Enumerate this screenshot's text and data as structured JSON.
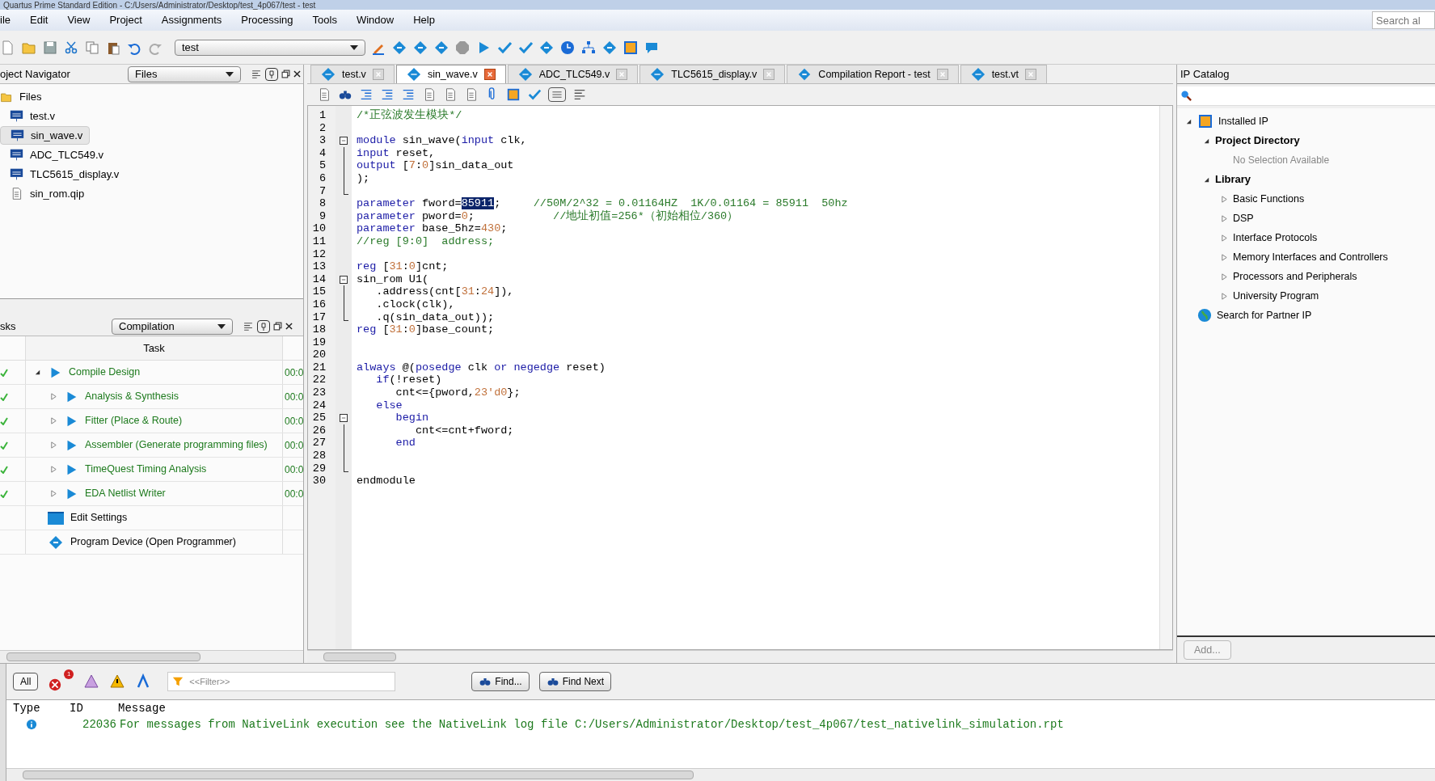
{
  "window": {
    "title": "Quartus Prime Standard Edition - C:/Users/Administrator/Desktop/test_4p067/test - test"
  },
  "menu": [
    "ile",
    "Edit",
    "View",
    "Project",
    "Assignments",
    "Processing",
    "Tools",
    "Window",
    "Help"
  ],
  "search": {
    "placeholder": "Search al"
  },
  "toolbar": {
    "revision": "test"
  },
  "navigator": {
    "title": "oject Navigator",
    "view": "Files",
    "files": [
      {
        "label": "Files",
        "kind": "folder",
        "selected": false
      },
      {
        "label": "test.v",
        "kind": "verilog",
        "selected": false
      },
      {
        "label": "sin_wave.v",
        "kind": "verilog",
        "selected": true
      },
      {
        "label": "ADC_TLC549.v",
        "kind": "verilog",
        "selected": false
      },
      {
        "label": "TLC5615_display.v",
        "kind": "verilog",
        "selected": false
      },
      {
        "label": "sin_rom.qip",
        "kind": "qip",
        "selected": false
      }
    ]
  },
  "tasks": {
    "title": "sks",
    "flow": "Compilation",
    "column": "Task",
    "rows": [
      {
        "label": "Compile Design",
        "kind": "flow",
        "done": true,
        "expanded": true,
        "time": "00:0",
        "children": [
          {
            "label": "Analysis & Synthesis",
            "kind": "flow",
            "done": true,
            "expanded": false,
            "time": "00:0"
          },
          {
            "label": "Fitter (Place & Route)",
            "kind": "flow",
            "done": true,
            "expanded": false,
            "time": "00:0"
          },
          {
            "label": "Assembler (Generate programming files)",
            "kind": "flow",
            "done": true,
            "expanded": false,
            "time": "00:0"
          },
          {
            "label": "TimeQuest Timing Analysis",
            "kind": "flow",
            "done": true,
            "expanded": false,
            "time": "00:0"
          },
          {
            "label": "EDA Netlist Writer",
            "kind": "flow",
            "done": true,
            "expanded": false,
            "time": "00:0"
          }
        ]
      },
      {
        "label": "Edit Settings",
        "kind": "settings",
        "done": false
      },
      {
        "label": "Program Device (Open Programmer)",
        "kind": "program",
        "done": false
      }
    ]
  },
  "tabs": [
    {
      "label": "test.v",
      "kind": "verilog",
      "selected": false
    },
    {
      "label": "sin_wave.v",
      "kind": "verilog",
      "selected": true
    },
    {
      "label": "ADC_TLC549.v",
      "kind": "verilog",
      "selected": false
    },
    {
      "label": "TLC5615_display.v",
      "kind": "verilog",
      "selected": false
    },
    {
      "label": "Compilation Report - test",
      "kind": "report",
      "selected": false
    },
    {
      "label": "test.vt",
      "kind": "verilog",
      "selected": false
    }
  ],
  "editor": {
    "lines": [
      {
        "number": "1",
        "kind": "plain",
        "tokens": [
          {
            "kind": "cmt",
            "text": "/*正弦波发生模块*/"
          }
        ]
      },
      {
        "number": "2",
        "kind": "plain"
      },
      {
        "number": "3",
        "kind": "fold_start",
        "tokens": [
          {
            "kind": "kw",
            "text": "module"
          },
          {
            "kind": "plain",
            "text": " sin_wave("
          },
          {
            "kind": "kw",
            "text": "input"
          },
          {
            "kind": "plain",
            "text": " clk,"
          }
        ]
      },
      {
        "number": "4",
        "kind": "fold_body",
        "tokens": [
          {
            "kind": "kw",
            "text": "input"
          },
          {
            "kind": "plain",
            "text": " reset,"
          }
        ]
      },
      {
        "number": "5",
        "kind": "fold_body",
        "tokens": [
          {
            "kind": "kw",
            "text": "output"
          },
          {
            "kind": "plain",
            "text": " ["
          },
          {
            "kind": "num",
            "text": "7"
          },
          {
            "kind": "plain",
            "text": ":"
          },
          {
            "kind": "num",
            "text": "0"
          },
          {
            "kind": "plain",
            "text": "]sin_data_out"
          }
        ]
      },
      {
        "number": "6",
        "kind": "fold_body",
        "tokens": [
          {
            "kind": "plain",
            "text": ");"
          }
        ]
      },
      {
        "number": "7",
        "kind": "fold_end"
      },
      {
        "number": "8",
        "kind": "plain",
        "tokens": [
          {
            "kind": "kw",
            "text": "parameter"
          },
          {
            "kind": "plain",
            "text": " fword="
          },
          {
            "kind": "sel",
            "text": "85911"
          },
          {
            "kind": "plain",
            "text": ";     "
          },
          {
            "kind": "cmt",
            "text": "//50M/2^32 = 0.01164HZ  1K/0.01164 = 85911  50hz"
          }
        ]
      },
      {
        "number": "9",
        "kind": "plain",
        "tokens": [
          {
            "kind": "kw",
            "text": "parameter"
          },
          {
            "kind": "plain",
            "text": " pword="
          },
          {
            "kind": "num",
            "text": "0"
          },
          {
            "kind": "plain",
            "text": ";            "
          },
          {
            "kind": "cmt",
            "text": "//地址初值=256*（初始相位/360）"
          }
        ]
      },
      {
        "number": "10",
        "kind": "plain",
        "tokens": [
          {
            "kind": "kw",
            "text": "parameter"
          },
          {
            "kind": "plain",
            "text": " base_5hz="
          },
          {
            "kind": "num",
            "text": "430"
          },
          {
            "kind": "plain",
            "text": ";"
          }
        ]
      },
      {
        "number": "11",
        "kind": "plain",
        "tokens": [
          {
            "kind": "cmt",
            "text": "//reg [9:0]  address;"
          }
        ]
      },
      {
        "number": "12",
        "kind": "plain"
      },
      {
        "number": "13",
        "kind": "plain",
        "tokens": [
          {
            "kind": "kw",
            "text": "reg"
          },
          {
            "kind": "plain",
            "text": " ["
          },
          {
            "kind": "num",
            "text": "31"
          },
          {
            "kind": "plain",
            "text": ":"
          },
          {
            "kind": "num",
            "text": "0"
          },
          {
            "kind": "plain",
            "text": "]cnt;"
          }
        ]
      },
      {
        "number": "14",
        "kind": "fold_start",
        "tokens": [
          {
            "kind": "plain",
            "text": "sin_rom U1("
          }
        ]
      },
      {
        "number": "15",
        "kind": "fold_body",
        "tokens": [
          {
            "kind": "plain",
            "text": "   .address(cnt["
          },
          {
            "kind": "num",
            "text": "31"
          },
          {
            "kind": "plain",
            "text": ":"
          },
          {
            "kind": "num",
            "text": "24"
          },
          {
            "kind": "plain",
            "text": "]),"
          }
        ]
      },
      {
        "number": "16",
        "kind": "fold_body",
        "tokens": [
          {
            "kind": "plain",
            "text": "   .clock(clk),"
          }
        ]
      },
      {
        "number": "17",
        "kind": "fold_end",
        "tokens": [
          {
            "kind": "plain",
            "text": "   .q(sin_data_out));"
          }
        ]
      },
      {
        "number": "18",
        "kind": "plain",
        "tokens": [
          {
            "kind": "kw",
            "text": "reg"
          },
          {
            "kind": "plain",
            "text": " ["
          },
          {
            "kind": "num",
            "text": "31"
          },
          {
            "kind": "plain",
            "text": ":"
          },
          {
            "kind": "num",
            "text": "0"
          },
          {
            "kind": "plain",
            "text": "]base_count;"
          }
        ]
      },
      {
        "number": "19",
        "kind": "plain"
      },
      {
        "number": "20",
        "kind": "plain"
      },
      {
        "number": "21",
        "kind": "plain",
        "tokens": [
          {
            "kind": "kw",
            "text": "always"
          },
          {
            "kind": "plain",
            "text": " @("
          },
          {
            "kind": "kw",
            "text": "posedge"
          },
          {
            "kind": "plain",
            "text": " clk "
          },
          {
            "kind": "kw",
            "text": "or"
          },
          {
            "kind": "kw",
            "text": " negedge"
          },
          {
            "kind": "plain",
            "text": " reset)"
          }
        ]
      },
      {
        "number": "22",
        "kind": "plain",
        "tokens": [
          {
            "kind": "kw",
            "text": "   if"
          },
          {
            "kind": "plain",
            "text": "(!reset)"
          }
        ]
      },
      {
        "number": "23",
        "kind": "plain",
        "tokens": [
          {
            "kind": "plain",
            "text": "      cnt<={pword,"
          },
          {
            "kind": "num",
            "text": "23'd0"
          },
          {
            "kind": "plain",
            "text": "};"
          }
        ]
      },
      {
        "number": "24",
        "kind": "plain",
        "tokens": [
          {
            "kind": "kw",
            "text": "   else"
          }
        ]
      },
      {
        "number": "25",
        "kind": "fold_start",
        "tokens": [
          {
            "kind": "kw",
            "text": "      begin"
          }
        ]
      },
      {
        "number": "26",
        "kind": "fold_body",
        "tokens": [
          {
            "kind": "plain",
            "text": "         cnt<=cnt+fword;"
          }
        ]
      },
      {
        "number": "27",
        "kind": "fold_body",
        "tokens": [
          {
            "kind": "kw",
            "text": "      end"
          }
        ]
      },
      {
        "number": "28",
        "kind": "fold_body"
      },
      {
        "number": "29",
        "kind": "fold_end"
      },
      {
        "number": "30",
        "kind": "plain",
        "tokens": [
          {
            "kind": "plain",
            "text": "endmodule"
          }
        ]
      }
    ]
  },
  "ip_catalog": {
    "title": "IP Catalog",
    "add_button": "Add...",
    "tree": [
      {
        "label": "Installed IP",
        "kind": "group",
        "expanded": true,
        "children": [
          {
            "label": "Project Directory",
            "kind": "category",
            "expanded": true,
            "children": [
              {
                "label": "No Selection Available",
                "kind": "note"
              }
            ]
          },
          {
            "label": "Library",
            "kind": "category",
            "expanded": true,
            "children": [
              {
                "label": "Basic Functions",
                "kind": "leaf",
                "expanded": false
              },
              {
                "label": "DSP",
                "kind": "leaf",
                "expanded": false
              },
              {
                "label": "Interface Protocols",
                "kind": "leaf",
                "expanded": false
              },
              {
                "label": "Memory Interfaces and Controllers",
                "kind": "leaf",
                "expanded": false
              },
              {
                "label": "Processors and Peripherals",
                "kind": "leaf",
                "expanded": false
              },
              {
                "label": "University Program",
                "kind": "leaf",
                "expanded": false
              }
            ]
          }
        ]
      },
      {
        "label": "Search for Partner IP",
        "kind": "link"
      }
    ]
  },
  "messages": {
    "all_button": "All",
    "error_count": "1",
    "filter_placeholder": "<<Filter>>",
    "find_button": "Find...",
    "find_next_button": "Find Next",
    "columns": [
      "Type",
      "ID",
      "Message"
    ],
    "rows": [
      {
        "kind": "info",
        "id": "22036",
        "message": "For messages from NativeLink execution see the NativeLink log file C:/Users/Administrator/Desktop/test_4p067/test_nativelink_simulation.rpt"
      }
    ]
  }
}
